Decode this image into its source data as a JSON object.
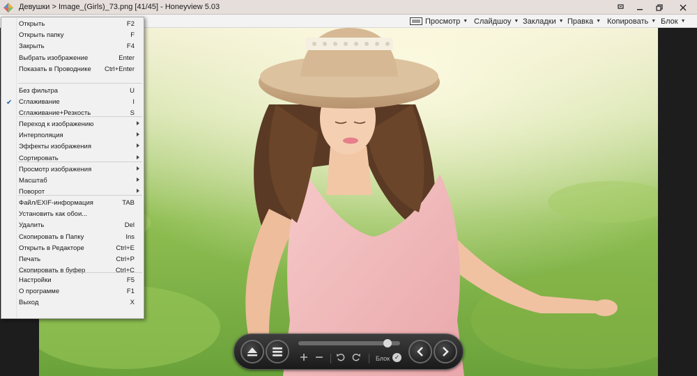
{
  "window": {
    "title": "Девушки > Image_(Girls)_73.png [41/45] - Honeyview 5.03"
  },
  "toolbar": {
    "view": "Просмотр",
    "slideshow": "Слайдшоу",
    "bookmarks": "Закладки",
    "edit": "Правка",
    "copy": "Копировать",
    "lock": "Блок"
  },
  "menu": {
    "items": [
      {
        "label": "Открыть",
        "shortcut": "F2"
      },
      {
        "label": "Открыть папку",
        "shortcut": "F"
      },
      {
        "label": "Закрыть",
        "shortcut": "F4"
      },
      {
        "label": "Выбрать изображение",
        "shortcut": "Enter"
      },
      {
        "label": "Показать в Проводнике",
        "shortcut": "Ctrl+Enter"
      },
      {
        "label": "Без фильтра",
        "shortcut": "U"
      },
      {
        "label": "Сглаживание",
        "shortcut": "I",
        "checked": true
      },
      {
        "label": "Сглаживание+Резкость",
        "shortcut": "S"
      },
      {
        "label": "Переход к изображению",
        "submenu": true
      },
      {
        "label": "Интерполяция",
        "submenu": true
      },
      {
        "label": "Эффекты изображения",
        "submenu": true
      },
      {
        "label": "Сортировать",
        "submenu": true
      },
      {
        "label": "Просмотр изображения",
        "submenu": true
      },
      {
        "label": "Масштаб",
        "submenu": true
      },
      {
        "label": "Поворот",
        "submenu": true
      },
      {
        "label": "Файл/EXIF-информация",
        "shortcut": "TAB"
      },
      {
        "label": "Установить как обои...",
        "shortcut": ""
      },
      {
        "label": "Удалить",
        "shortcut": "Del"
      },
      {
        "label": "Скопировать в Папку",
        "shortcut": "Ins"
      },
      {
        "label": "Открыть в Редакторе",
        "shortcut": "Ctrl+E"
      },
      {
        "label": "Печать",
        "shortcut": "Ctrl+P"
      },
      {
        "label": "Скопировать в буфер",
        "shortcut": "Ctrl+C"
      },
      {
        "label": "Настройки",
        "shortcut": "F5"
      },
      {
        "label": "О программе",
        "shortcut": "F1"
      },
      {
        "label": "Выход",
        "shortcut": "X"
      }
    ]
  },
  "controls": {
    "lock_label": "Блок",
    "image_position_fraction": 0.88
  },
  "icons": {
    "eject": "eject-icon",
    "menu": "hamburger-icon",
    "zoom_in": "plus-icon",
    "zoom_out": "minus-icon",
    "rotate_left": "rotate-left-icon",
    "rotate_right": "rotate-right-icon",
    "prev": "chevron-left-icon",
    "next": "chevron-right-icon"
  },
  "colors": {
    "titlebar": "#e5dedb",
    "toolbar": "#f3f3f3",
    "menu_bg": "#f1f1f1",
    "check": "#1f5fb4"
  }
}
